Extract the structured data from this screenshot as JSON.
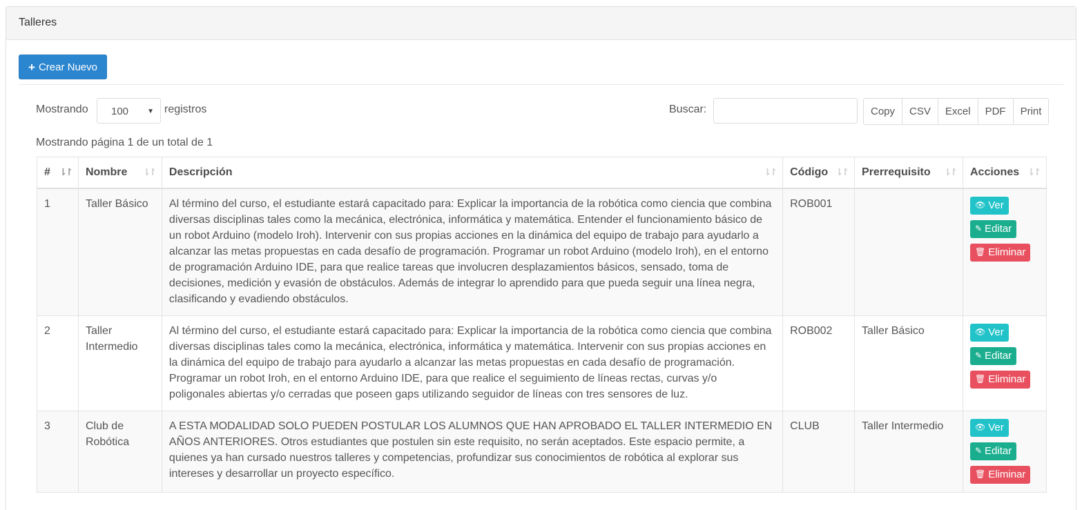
{
  "panel": {
    "title": "Talleres"
  },
  "toolbar": {
    "create_label": "Crear Nuevo",
    "create_icon": "plus-icon"
  },
  "length": {
    "label": "Mostrando",
    "value": "100",
    "suffix": "registros"
  },
  "search": {
    "label": "Buscar:",
    "value": ""
  },
  "export": [
    "Copy",
    "CSV",
    "Excel",
    "PDF",
    "Print"
  ],
  "page_info": "Mostrando página 1 de un total de 1",
  "table": {
    "headers": [
      "#",
      "Nombre",
      "Descripción",
      "Código",
      "Prerrequisito",
      "Acciones"
    ],
    "rows": [
      {
        "num": "1",
        "name": "Taller Básico",
        "description": "Al término del curso, el estudiante estará capacitado para: Explicar la importancia de la robótica como ciencia que combina diversas disciplinas tales como la mecánica, electrónica, informática y matemática. Entender el funcionamiento básico de un robot Arduino (modelo Iroh). Intervenir con sus propias acciones en la dinámica del equipo de trabajo para ayudarlo a alcanzar las metas propuestas en cada desafío de programación. Programar un robot Arduino (modelo Iroh), en el entorno de programación Arduino IDE, para que realice tareas que involucren desplazamientos básicos, sensado, toma de decisiones, medición y evasión de obstáculos. Además de integrar lo aprendido para que pueda seguir una línea negra, clasificando y evadiendo obstáculos.",
        "code": "ROB001",
        "prereq": ""
      },
      {
        "num": "2",
        "name": "Taller Intermedio",
        "description": "Al término del curso, el estudiante estará capacitado para: Explicar la importancia de la robótica como ciencia que combina diversas disciplinas tales como la mecánica, electrónica, informática y matemática. Intervenir con sus propias acciones en la dinámica del equipo de trabajo para ayudarlo a alcanzar las metas propuestas en cada desafío de programación. Programar un robot Iroh, en el entorno Arduino IDE, para que realice el seguimiento de líneas rectas, curvas y/o poligonales abiertas y/o cerradas que poseen gaps utilizando seguidor de líneas con tres sensores de luz.",
        "code": "ROB002",
        "prereq": "Taller Básico"
      },
      {
        "num": "3",
        "name": "Club de Robótica",
        "description": "A ESTA MODALIDAD SOLO PUEDEN POSTULAR LOS ALUMNOS QUE HAN APROBADO EL TALLER INTERMEDIO EN AÑOS ANTERIORES. Otros estudiantes que postulen sin este requisito, no serán aceptados. Este espacio permite, a quienes ya han cursado nuestros talleres y competencias, profundizar sus conocimientos de robótica al explorar sus intereses y desarrollar un proyecto específico.",
        "code": "CLUB",
        "prereq": "Taller Intermedio"
      }
    ],
    "actions": {
      "view": "Ver",
      "edit": "Editar",
      "delete": "Eliminar"
    }
  },
  "colors": {
    "primary": "#2c86cf",
    "info": "#21c3c9",
    "success": "#1aae8f",
    "danger": "#e8505f"
  }
}
